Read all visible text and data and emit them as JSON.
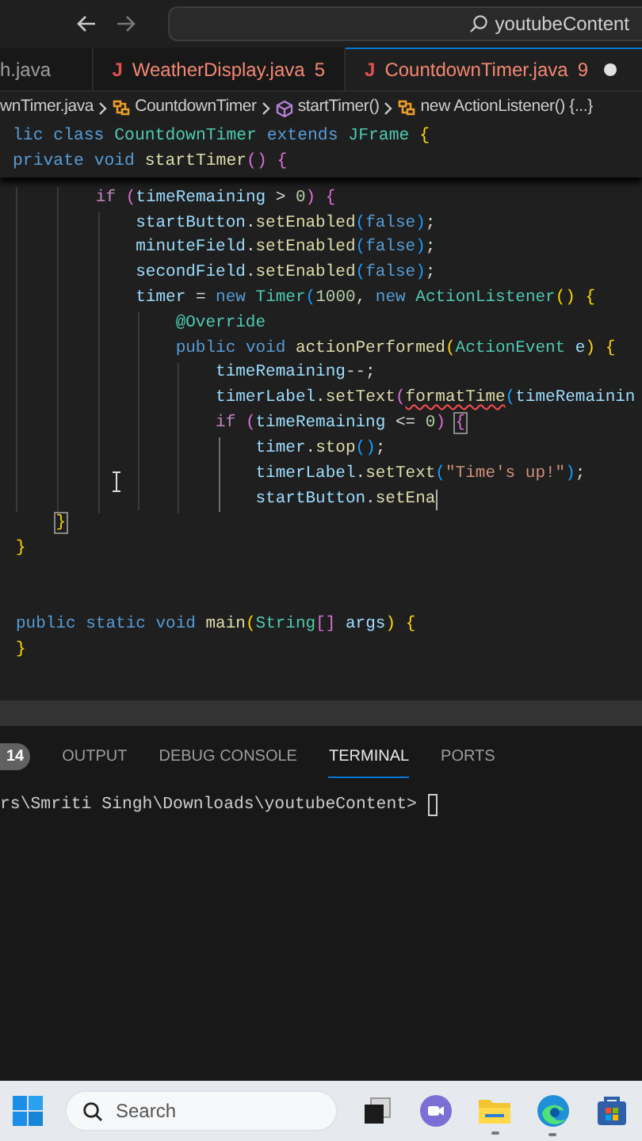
{
  "title_bar": {
    "search_text": "youtubeContent"
  },
  "editor_tabs": [
    {
      "label": "h.java",
      "error": false,
      "modified": false,
      "selected": false
    },
    {
      "icon_text": "J",
      "label": "WeatherDisplay.java",
      "problems": "5",
      "error": true,
      "modified": false,
      "selected": false
    },
    {
      "icon_text": "J",
      "label": "CountdownTimer.java",
      "problems": "9",
      "error": true,
      "modified": true,
      "selected": true
    }
  ],
  "breadcrumb": [
    {
      "label": "wnTimer.java",
      "kind": "file"
    },
    {
      "label": "CountdownTimer",
      "kind": "class"
    },
    {
      "label": "startTimer()",
      "kind": "method"
    },
    {
      "label": "new ActionListener() {...}",
      "kind": "class"
    }
  ],
  "sticky_lines": [
    {
      "kind": "code",
      "caret": false,
      "tokens": [
        {
          "text": "lic ",
          "kind": "kw"
        },
        {
          "text": "class ",
          "kind": "kw"
        },
        {
          "text": "CountdownTimer ",
          "kind": "type"
        },
        {
          "text": "extends ",
          "kind": "kw"
        },
        {
          "text": "JFrame ",
          "kind": "type"
        },
        {
          "text": "{",
          "kind": "b1"
        }
      ]
    },
    {
      "kind": "code",
      "caret": false,
      "tokens": [
        {
          "text": "private ",
          "kind": "kw"
        },
        {
          "text": "void ",
          "kind": "kw"
        },
        {
          "text": "startTimer",
          "kind": "fn"
        },
        {
          "text": "() ",
          "kind": "b2"
        },
        {
          "text": "{",
          "kind": "b2"
        }
      ]
    }
  ],
  "code_lines": [
    {
      "kind": "code",
      "caret": false,
      "tokens": [
        {
          "text": "        if ",
          "kind": "ctrl"
        },
        {
          "text": "(",
          "kind": "b2"
        },
        {
          "text": "timeRemaining ",
          "kind": "var"
        },
        {
          "text": "> ",
          "kind": "p"
        },
        {
          "text": "0",
          "kind": "num"
        },
        {
          "text": ") ",
          "kind": "b2"
        },
        {
          "text": "{",
          "kind": "b2"
        }
      ]
    },
    {
      "kind": "code",
      "caret": false,
      "tokens": [
        {
          "text": "            startButton",
          "kind": "var"
        },
        {
          "text": ".",
          "kind": "p"
        },
        {
          "text": "setEnabled",
          "kind": "fn"
        },
        {
          "text": "(",
          "kind": "b3"
        },
        {
          "text": "false",
          "kind": "kw"
        },
        {
          "text": ")",
          "kind": "b3"
        },
        {
          "text": ";",
          "kind": "p"
        }
      ]
    },
    {
      "kind": "code",
      "caret": false,
      "tokens": [
        {
          "text": "            minuteField",
          "kind": "var"
        },
        {
          "text": ".",
          "kind": "p"
        },
        {
          "text": "setEnabled",
          "kind": "fn"
        },
        {
          "text": "(",
          "kind": "b3"
        },
        {
          "text": "false",
          "kind": "kw"
        },
        {
          "text": ")",
          "kind": "b3"
        },
        {
          "text": ";",
          "kind": "p"
        }
      ]
    },
    {
      "kind": "code",
      "caret": false,
      "tokens": [
        {
          "text": "            secondField",
          "kind": "var"
        },
        {
          "text": ".",
          "kind": "p"
        },
        {
          "text": "setEnabled",
          "kind": "fn"
        },
        {
          "text": "(",
          "kind": "b3"
        },
        {
          "text": "false",
          "kind": "kw"
        },
        {
          "text": ")",
          "kind": "b3"
        },
        {
          "text": ";",
          "kind": "p"
        }
      ]
    },
    {
      "kind": "code",
      "caret": false,
      "tokens": [
        {
          "text": "            timer ",
          "kind": "var"
        },
        {
          "text": "= ",
          "kind": "p"
        },
        {
          "text": "new ",
          "kind": "kw"
        },
        {
          "text": "Timer",
          "kind": "type"
        },
        {
          "text": "(",
          "kind": "b3"
        },
        {
          "text": "1000",
          "kind": "num"
        },
        {
          "text": ", ",
          "kind": "p"
        },
        {
          "text": "new ",
          "kind": "kw"
        },
        {
          "text": "ActionListener",
          "kind": "type"
        },
        {
          "text": "() ",
          "kind": "b1"
        },
        {
          "text": "{",
          "kind": "b1"
        }
      ]
    },
    {
      "kind": "code",
      "caret": false,
      "tokens": [
        {
          "text": "                @Override",
          "kind": "type"
        }
      ]
    },
    {
      "kind": "code",
      "caret": false,
      "tokens": [
        {
          "text": "                public ",
          "kind": "kw"
        },
        {
          "text": "void ",
          "kind": "kw"
        },
        {
          "text": "actionPerformed",
          "kind": "fn"
        },
        {
          "text": "(",
          "kind": "b1"
        },
        {
          "text": "ActionEvent ",
          "kind": "type"
        },
        {
          "text": "e",
          "kind": "var"
        },
        {
          "text": ") ",
          "kind": "b1"
        },
        {
          "text": "{",
          "kind": "b1"
        }
      ]
    },
    {
      "kind": "code",
      "caret": false,
      "tokens": [
        {
          "text": "                    timeRemaining",
          "kind": "var"
        },
        {
          "text": "--;",
          "kind": "p"
        }
      ]
    },
    {
      "kind": "code",
      "caret": false,
      "tokens": [
        {
          "text": "                    timerLabel",
          "kind": "var"
        },
        {
          "text": ".",
          "kind": "p"
        },
        {
          "text": "setText",
          "kind": "fn"
        },
        {
          "text": "(",
          "kind": "b2"
        },
        {
          "text": "formatTime",
          "kind": "fn_error"
        },
        {
          "text": "(",
          "kind": "b3"
        },
        {
          "text": "timeRemainin",
          "kind": "var"
        }
      ]
    },
    {
      "kind": "code",
      "caret": false,
      "tokens": [
        {
          "text": "                    if ",
          "kind": "ctrl"
        },
        {
          "text": "(",
          "kind": "b2"
        },
        {
          "text": "timeRemaining ",
          "kind": "var"
        },
        {
          "text": "<= ",
          "kind": "p"
        },
        {
          "text": "0",
          "kind": "num"
        },
        {
          "text": ") ",
          "kind": "b2"
        },
        {
          "text": "{",
          "kind": "b2_match"
        }
      ]
    },
    {
      "kind": "code",
      "caret": false,
      "tokens": [
        {
          "text": "                        timer",
          "kind": "var"
        },
        {
          "text": ".",
          "kind": "p"
        },
        {
          "text": "stop",
          "kind": "fn"
        },
        {
          "text": "()",
          "kind": "b3"
        },
        {
          "text": ";",
          "kind": "p"
        }
      ]
    },
    {
      "kind": "code",
      "caret": false,
      "tokens": [
        {
          "text": "                        timerLabel",
          "kind": "var"
        },
        {
          "text": ".",
          "kind": "p"
        },
        {
          "text": "setText",
          "kind": "fn"
        },
        {
          "text": "(",
          "kind": "b3"
        },
        {
          "text": "\"Time's up!\"",
          "kind": "str"
        },
        {
          "text": ")",
          "kind": "b3"
        },
        {
          "text": ";",
          "kind": "p"
        }
      ]
    },
    {
      "kind": "code",
      "caret": true,
      "tokens": [
        {
          "text": "                        startButton",
          "kind": "var"
        },
        {
          "text": ".",
          "kind": "p"
        },
        {
          "text": "setEna",
          "kind": "fn"
        }
      ]
    },
    {
      "kind": "code",
      "caret": false,
      "tokens": [
        {
          "text": "    }",
          "kind": "b1_match"
        }
      ]
    },
    {
      "kind": "code",
      "caret": false,
      "tokens": [
        {
          "text": "}",
          "kind": "b1"
        }
      ]
    },
    {
      "kind": "blank"
    },
    {
      "kind": "blank"
    },
    {
      "kind": "code",
      "caret": false,
      "tokens": [
        {
          "text": "public ",
          "kind": "kw"
        },
        {
          "text": "static ",
          "kind": "kw"
        },
        {
          "text": "void ",
          "kind": "kw"
        },
        {
          "text": "main",
          "kind": "fn"
        },
        {
          "text": "(",
          "kind": "b1"
        },
        {
          "text": "String",
          "kind": "type"
        },
        {
          "text": "[]",
          "kind": "b2"
        },
        {
          "text": " args",
          "kind": "var"
        },
        {
          "text": ") ",
          "kind": "b1"
        },
        {
          "text": "{",
          "kind": "b1"
        }
      ]
    },
    {
      "kind": "code",
      "caret": false,
      "tokens": [
        {
          "text": "}",
          "kind": "b1"
        }
      ]
    }
  ],
  "panel": {
    "problems_count": "14",
    "tabs": [
      {
        "label": "OUTPUT",
        "selected": false
      },
      {
        "label": "DEBUG CONSOLE",
        "selected": false
      },
      {
        "label": "TERMINAL",
        "selected": true
      },
      {
        "label": "PORTS",
        "selected": false
      }
    ],
    "terminal_line": "rs\\Smriti Singh\\Downloads\\youtubeContent>"
  },
  "taskbar": {
    "search_placeholder": "Search",
    "apps": [
      {
        "kind": "task-view",
        "running": false
      },
      {
        "kind": "chat",
        "running": false
      },
      {
        "kind": "files",
        "running": true
      },
      {
        "kind": "browser",
        "running": true
      },
      {
        "kind": "store",
        "running": false
      }
    ]
  }
}
